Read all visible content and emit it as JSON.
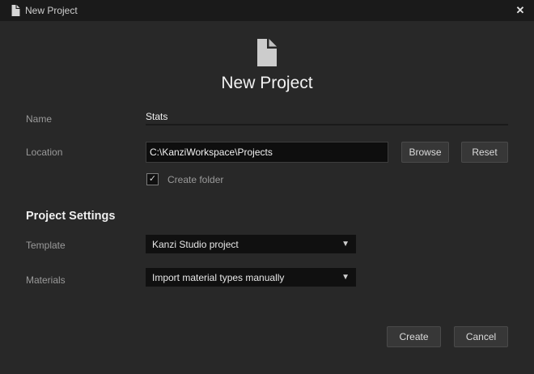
{
  "window": {
    "title": "New Project"
  },
  "header": {
    "title": "New Project"
  },
  "icons": {
    "close": "✕",
    "check": "✓",
    "dropdown_arrow": "▼"
  },
  "form": {
    "name": {
      "label": "Name",
      "value": "Stats"
    },
    "location": {
      "label": "Location",
      "value": "C:\\KanziWorkspace\\Projects",
      "browse_label": "Browse",
      "reset_label": "Reset"
    },
    "create_folder": {
      "label": "Create folder",
      "checked": true
    },
    "settings_heading": "Project Settings",
    "template": {
      "label": "Template",
      "value": "Kanzi Studio project"
    },
    "materials": {
      "label": "Materials",
      "value": "Import material types manually"
    }
  },
  "footer": {
    "create_label": "Create",
    "cancel_label": "Cancel"
  },
  "colors": {
    "titlebar_bg": "#1a1a1a",
    "dialog_bg": "#282828",
    "field_bg": "#0e0e0e",
    "button_bg": "#373737"
  }
}
